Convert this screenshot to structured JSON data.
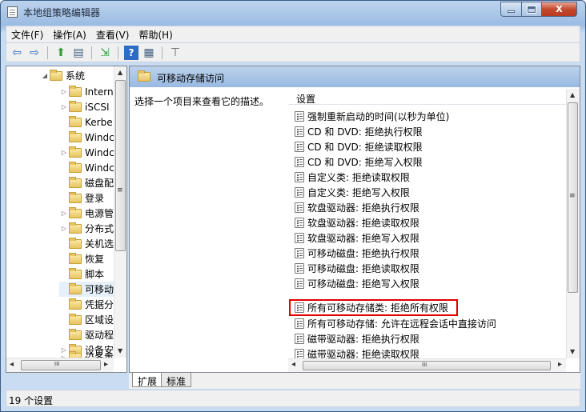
{
  "window": {
    "title": "本地组策略编辑器",
    "minimize": "—",
    "maximize": "□",
    "close": "X"
  },
  "menu": [
    {
      "label": "文件(F)"
    },
    {
      "label": "操作(A)"
    },
    {
      "label": "查看(V)"
    },
    {
      "label": "帮助(H)"
    }
  ],
  "toolbar": {
    "back": "⇦",
    "forward": "⇨",
    "up": "⬆",
    "show_hide": "▤",
    "export": "⇲",
    "help": "?",
    "properties": "▦",
    "filter": "⊤"
  },
  "tree": {
    "root": {
      "label": "系统",
      "arrow": "◢"
    },
    "items": [
      {
        "label": "Intern",
        "arrow": "▷"
      },
      {
        "label": "iSCSI",
        "arrow": "▷"
      },
      {
        "label": "Kerbe",
        "arrow": ""
      },
      {
        "label": "Windc",
        "arrow": ""
      },
      {
        "label": "Windc",
        "arrow": "▷"
      },
      {
        "label": "Windc",
        "arrow": ""
      },
      {
        "label": "磁盘配",
        "arrow": ""
      },
      {
        "label": "登录",
        "arrow": ""
      },
      {
        "label": "电源管",
        "arrow": "▷"
      },
      {
        "label": "分布式",
        "arrow": "▷"
      },
      {
        "label": "关机选",
        "arrow": ""
      },
      {
        "label": "恢复",
        "arrow": ""
      },
      {
        "label": "脚本",
        "arrow": ""
      },
      {
        "label": "可移动",
        "arrow": ""
      },
      {
        "label": "凭据分",
        "arrow": ""
      },
      {
        "label": "区域设",
        "arrow": ""
      },
      {
        "label": "驱动程",
        "arrow": ""
      },
      {
        "label": "设备安",
        "arrow": "▷"
      },
      {
        "label": "设备重",
        "arrow": "▷"
      }
    ],
    "scroll_up": "▲",
    "scroll_down": "▼",
    "scroll_left": "◂",
    "scroll_right": "▸",
    "scroll_grip": "≡",
    "h_grip": "III"
  },
  "details": {
    "header": "可移动存储访问",
    "description": "选择一个项目来查看它的描述。",
    "column": "设置",
    "rows": [
      {
        "label": "强制重新启动的时间(以秒为单位)"
      },
      {
        "label": "CD 和 DVD: 拒绝执行权限"
      },
      {
        "label": "CD 和 DVD: 拒绝读取权限"
      },
      {
        "label": "CD 和 DVD: 拒绝写入权限"
      },
      {
        "label": "自定义类: 拒绝读取权限"
      },
      {
        "label": "自定义类: 拒绝写入权限"
      },
      {
        "label": "软盘驱动器: 拒绝执行权限"
      },
      {
        "label": "软盘驱动器: 拒绝读取权限"
      },
      {
        "label": "软盘驱动器: 拒绝写入权限"
      },
      {
        "label": "可移动磁盘: 拒绝执行权限"
      },
      {
        "label": "可移动磁盘: 拒绝读取权限"
      },
      {
        "label": "可移动磁盘: 拒绝写入权限"
      },
      {
        "label": "所有可移动存储类: 拒绝所有权限"
      },
      {
        "label": "所有可移动存储: 允许在远程会话中直接访问"
      },
      {
        "label": "磁带驱动器: 拒绝执行权限"
      },
      {
        "label": "磁带驱动器: 拒绝读取权限"
      }
    ],
    "highlight_color": "#e00000"
  },
  "tabs": [
    {
      "label": "扩展"
    },
    {
      "label": "标准"
    }
  ],
  "status": "19 个设置"
}
